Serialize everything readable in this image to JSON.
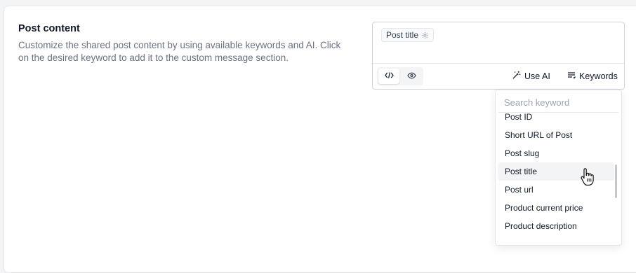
{
  "section": {
    "title": "Post content",
    "description": "Customize the shared post content by using available keywords and AI. Click on the desired keyword to add it to the custom message section."
  },
  "editor": {
    "chip_label": "Post title",
    "chip_icon": "settings-icon",
    "mode_code_icon": "code-icon",
    "mode_preview_icon": "eye-icon",
    "use_ai_label": "Use AI",
    "use_ai_icon": "magic-wand-icon",
    "keywords_label": "Keywords",
    "keywords_icon": "list-icon"
  },
  "keyword_dropdown": {
    "search_placeholder": "Search keyword",
    "items": [
      "Post ID",
      "Short URL of Post",
      "Post slug",
      "Post title",
      "Post url",
      "Product current price",
      "Product description"
    ],
    "hovered_item": "Post title"
  },
  "colors": {
    "text_primary": "#111827",
    "text_muted": "#6b7280",
    "border": "#e5e7eb",
    "hover_bg": "#f3f4f6"
  }
}
